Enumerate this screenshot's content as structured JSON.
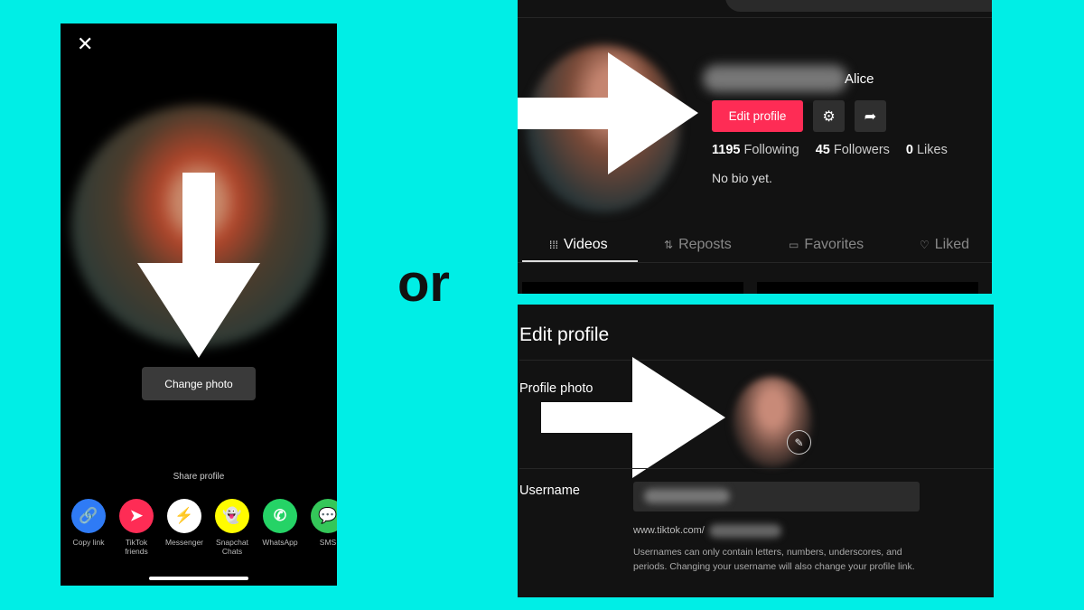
{
  "separator_text": "or",
  "share_sheet": {
    "change_photo_label": "Change photo",
    "share_profile_label": "Share profile",
    "items": [
      {
        "label": "Copy link",
        "icon": "link-icon",
        "color": "#2f7bf5",
        "glyph": "🔗"
      },
      {
        "label": "TikTok\nfriends",
        "icon": "send-icon",
        "color": "#fe2c55",
        "glyph": "➤"
      },
      {
        "label": "Messenger",
        "icon": "messenger-icon",
        "color": "#ffffff",
        "glyph": "⚡"
      },
      {
        "label": "Snapchat\nChats",
        "icon": "snapchat-icon",
        "color": "#fffc00",
        "glyph": "👻"
      },
      {
        "label": "WhatsApp",
        "icon": "whatsapp-icon",
        "color": "#25d366",
        "glyph": "✆"
      },
      {
        "label": "SMS",
        "icon": "sms-icon",
        "color": "#34c759",
        "glyph": "💬"
      }
    ]
  },
  "profile": {
    "name_suffix": "Alice",
    "edit_button": "Edit profile",
    "following_count": "1195",
    "following_label": "Following",
    "followers_count": "45",
    "followers_label": "Followers",
    "likes_count": "0",
    "likes_label": "Likes",
    "bio": "No bio yet.",
    "tabs": [
      {
        "label": "Videos",
        "icon": "grid-icon",
        "glyph": "⁞⁞⁞"
      },
      {
        "label": "Reposts",
        "icon": "repost-icon",
        "glyph": "⇅"
      },
      {
        "label": "Favorites",
        "icon": "bookmark-icon",
        "glyph": "▭"
      },
      {
        "label": "Liked",
        "icon": "heart-icon",
        "glyph": "♡"
      }
    ],
    "accent": "#fe2c55"
  },
  "edit_profile": {
    "title": "Edit profile",
    "photo_label": "Profile photo",
    "username_label": "Username",
    "url_prefix": "www.tiktok.com/",
    "hint": "Usernames can only contain letters, numbers, underscores, and periods. Changing your username will also change your profile link."
  }
}
